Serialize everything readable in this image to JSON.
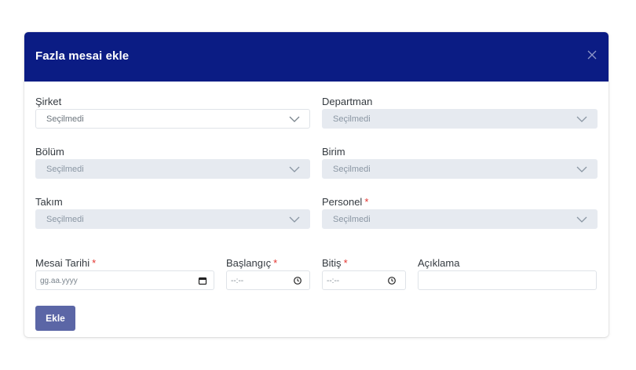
{
  "modal": {
    "title": "Fazla mesai ekle",
    "colors": {
      "header_bg": "#0b1c84",
      "button_bg": "#5b66a6",
      "required": "#e3342f"
    }
  },
  "fields": {
    "sirket": {
      "label": "Şirket",
      "value": "Seçilmedi",
      "enabled": true
    },
    "departman": {
      "label": "Departman",
      "value": "Seçilmedi",
      "enabled": false
    },
    "bolum": {
      "label": "Bölüm",
      "value": "Seçilmedi",
      "enabled": false
    },
    "birim": {
      "label": "Birim",
      "value": "Seçilmedi",
      "enabled": false
    },
    "takim": {
      "label": "Takım",
      "value": "Seçilmedi",
      "enabled": false
    },
    "personel": {
      "label": "Personel",
      "value": "Seçilmedi",
      "enabled": false,
      "required": "*"
    },
    "mesai_tarihi": {
      "label": "Mesai Tarihi",
      "placeholder": "gg.aa.yyyy",
      "required": "*",
      "icon": "calendar-icon"
    },
    "baslangic": {
      "label": "Başlangıç",
      "placeholder": "--:--",
      "required": "*",
      "icon": "clock-icon"
    },
    "bitis": {
      "label": "Bitiş",
      "placeholder": "--:--",
      "required": "*",
      "icon": "clock-icon"
    },
    "aciklama": {
      "label": "Açıklama",
      "value": ""
    }
  },
  "actions": {
    "submit_label": "Ekle"
  }
}
